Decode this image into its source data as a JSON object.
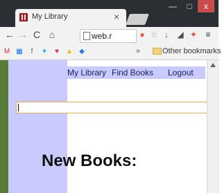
{
  "browser": {
    "tab_title": "My Library",
    "tab_close_symbol": "×",
    "address": "web.r",
    "bookmarks": {
      "overflow_symbol": "»",
      "other_bookmarks": "Other bookmarks"
    },
    "window_controls": {
      "minimize": "—",
      "maximize": "□",
      "close": "x"
    }
  },
  "page": {
    "nav": {
      "my_library": "My Library",
      "find_books": "Find Books",
      "logout": "Logout"
    },
    "search_value": "",
    "heading": "New Books:"
  },
  "colors": {
    "sidebar": "#c9cafe",
    "chrome_dark": "#2b2f33",
    "input_border": "#e0b44a"
  }
}
